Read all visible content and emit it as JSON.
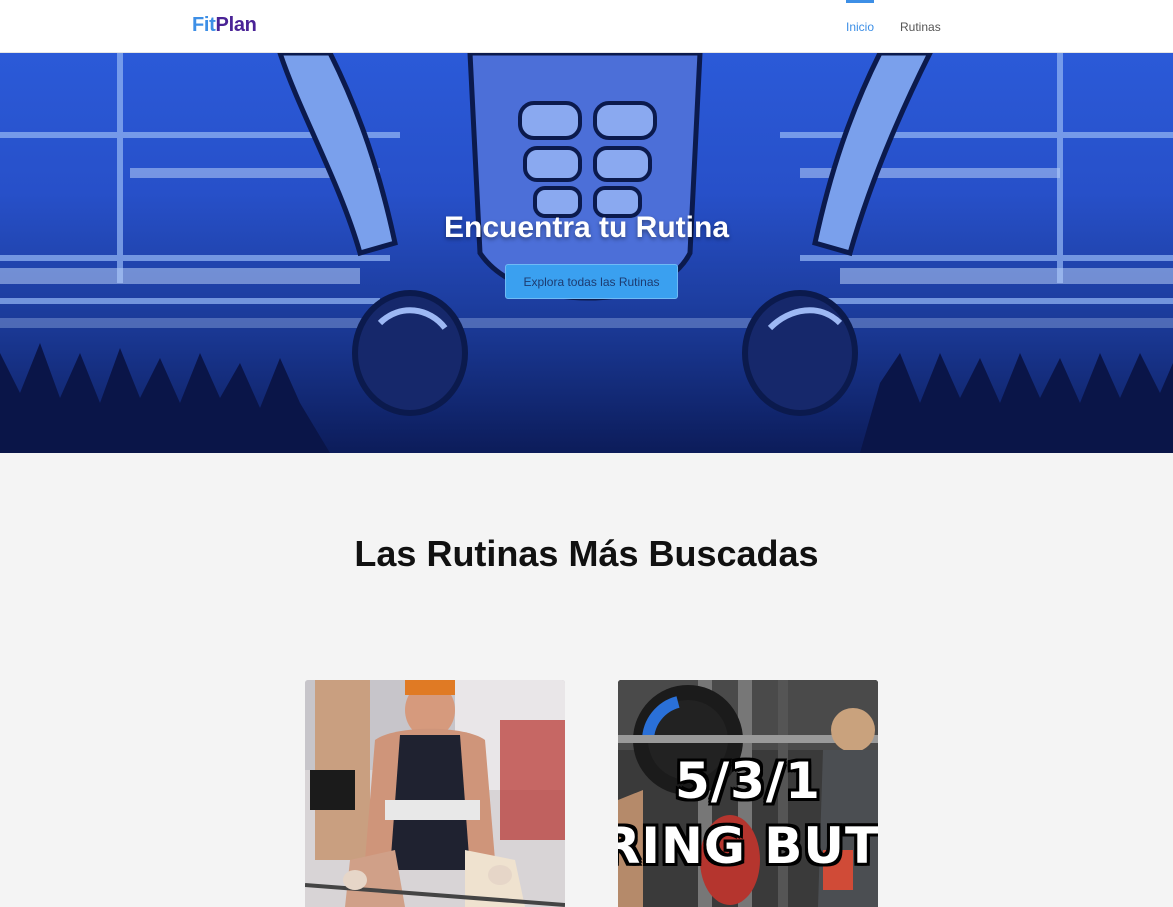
{
  "navbar": {
    "brand_part1": "Fit",
    "brand_part2": "Plan",
    "links": [
      {
        "label": "Inicio",
        "active": true
      },
      {
        "label": "Rutinas",
        "active": false
      }
    ]
  },
  "hero": {
    "title": "Encuentra tu Rutina",
    "button_label": "Explora todas las Rutinas"
  },
  "section": {
    "title": "Las Rutinas Más Buscadas"
  },
  "cards": [
    {
      "image": "powerlifter-deadlift-photo"
    },
    {
      "image": "531-program-thumbnail",
      "line1": "5/3/1",
      "line2": "ORING BUT B"
    }
  ],
  "colors": {
    "accent": "#3d8fe6",
    "brand_dark": "#4a2396",
    "hero_button": "#3aa0f0"
  }
}
